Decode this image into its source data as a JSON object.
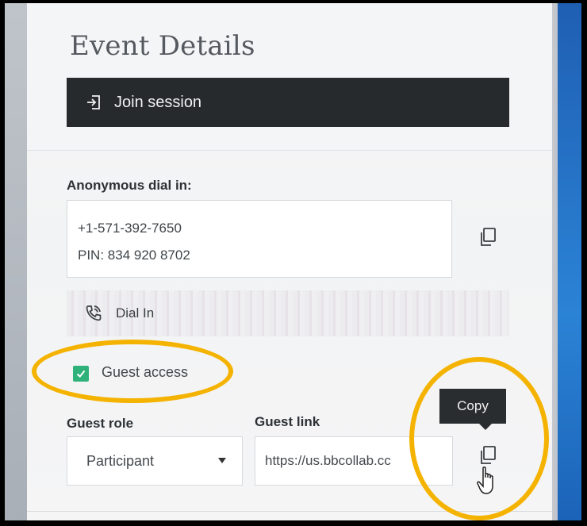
{
  "panel": {
    "title": "Event Details",
    "join_label": "Join session"
  },
  "dial_in": {
    "label": "Anonymous dial in:",
    "phone": "+1-571-392-7650",
    "pin": "PIN: 834 920 8702",
    "button_label": "Dial In"
  },
  "guest": {
    "access_label": "Guest access",
    "access_checked": true,
    "role_label": "Guest role",
    "role_value": "Participant",
    "link_label": "Guest link",
    "link_value": "https://us.bbcollab.cc"
  },
  "tooltip": {
    "text": "Copy"
  },
  "colors": {
    "highlight_ring": "#f5b301",
    "checkbox": "#2fb27a",
    "button_dark": "#262a2d"
  }
}
